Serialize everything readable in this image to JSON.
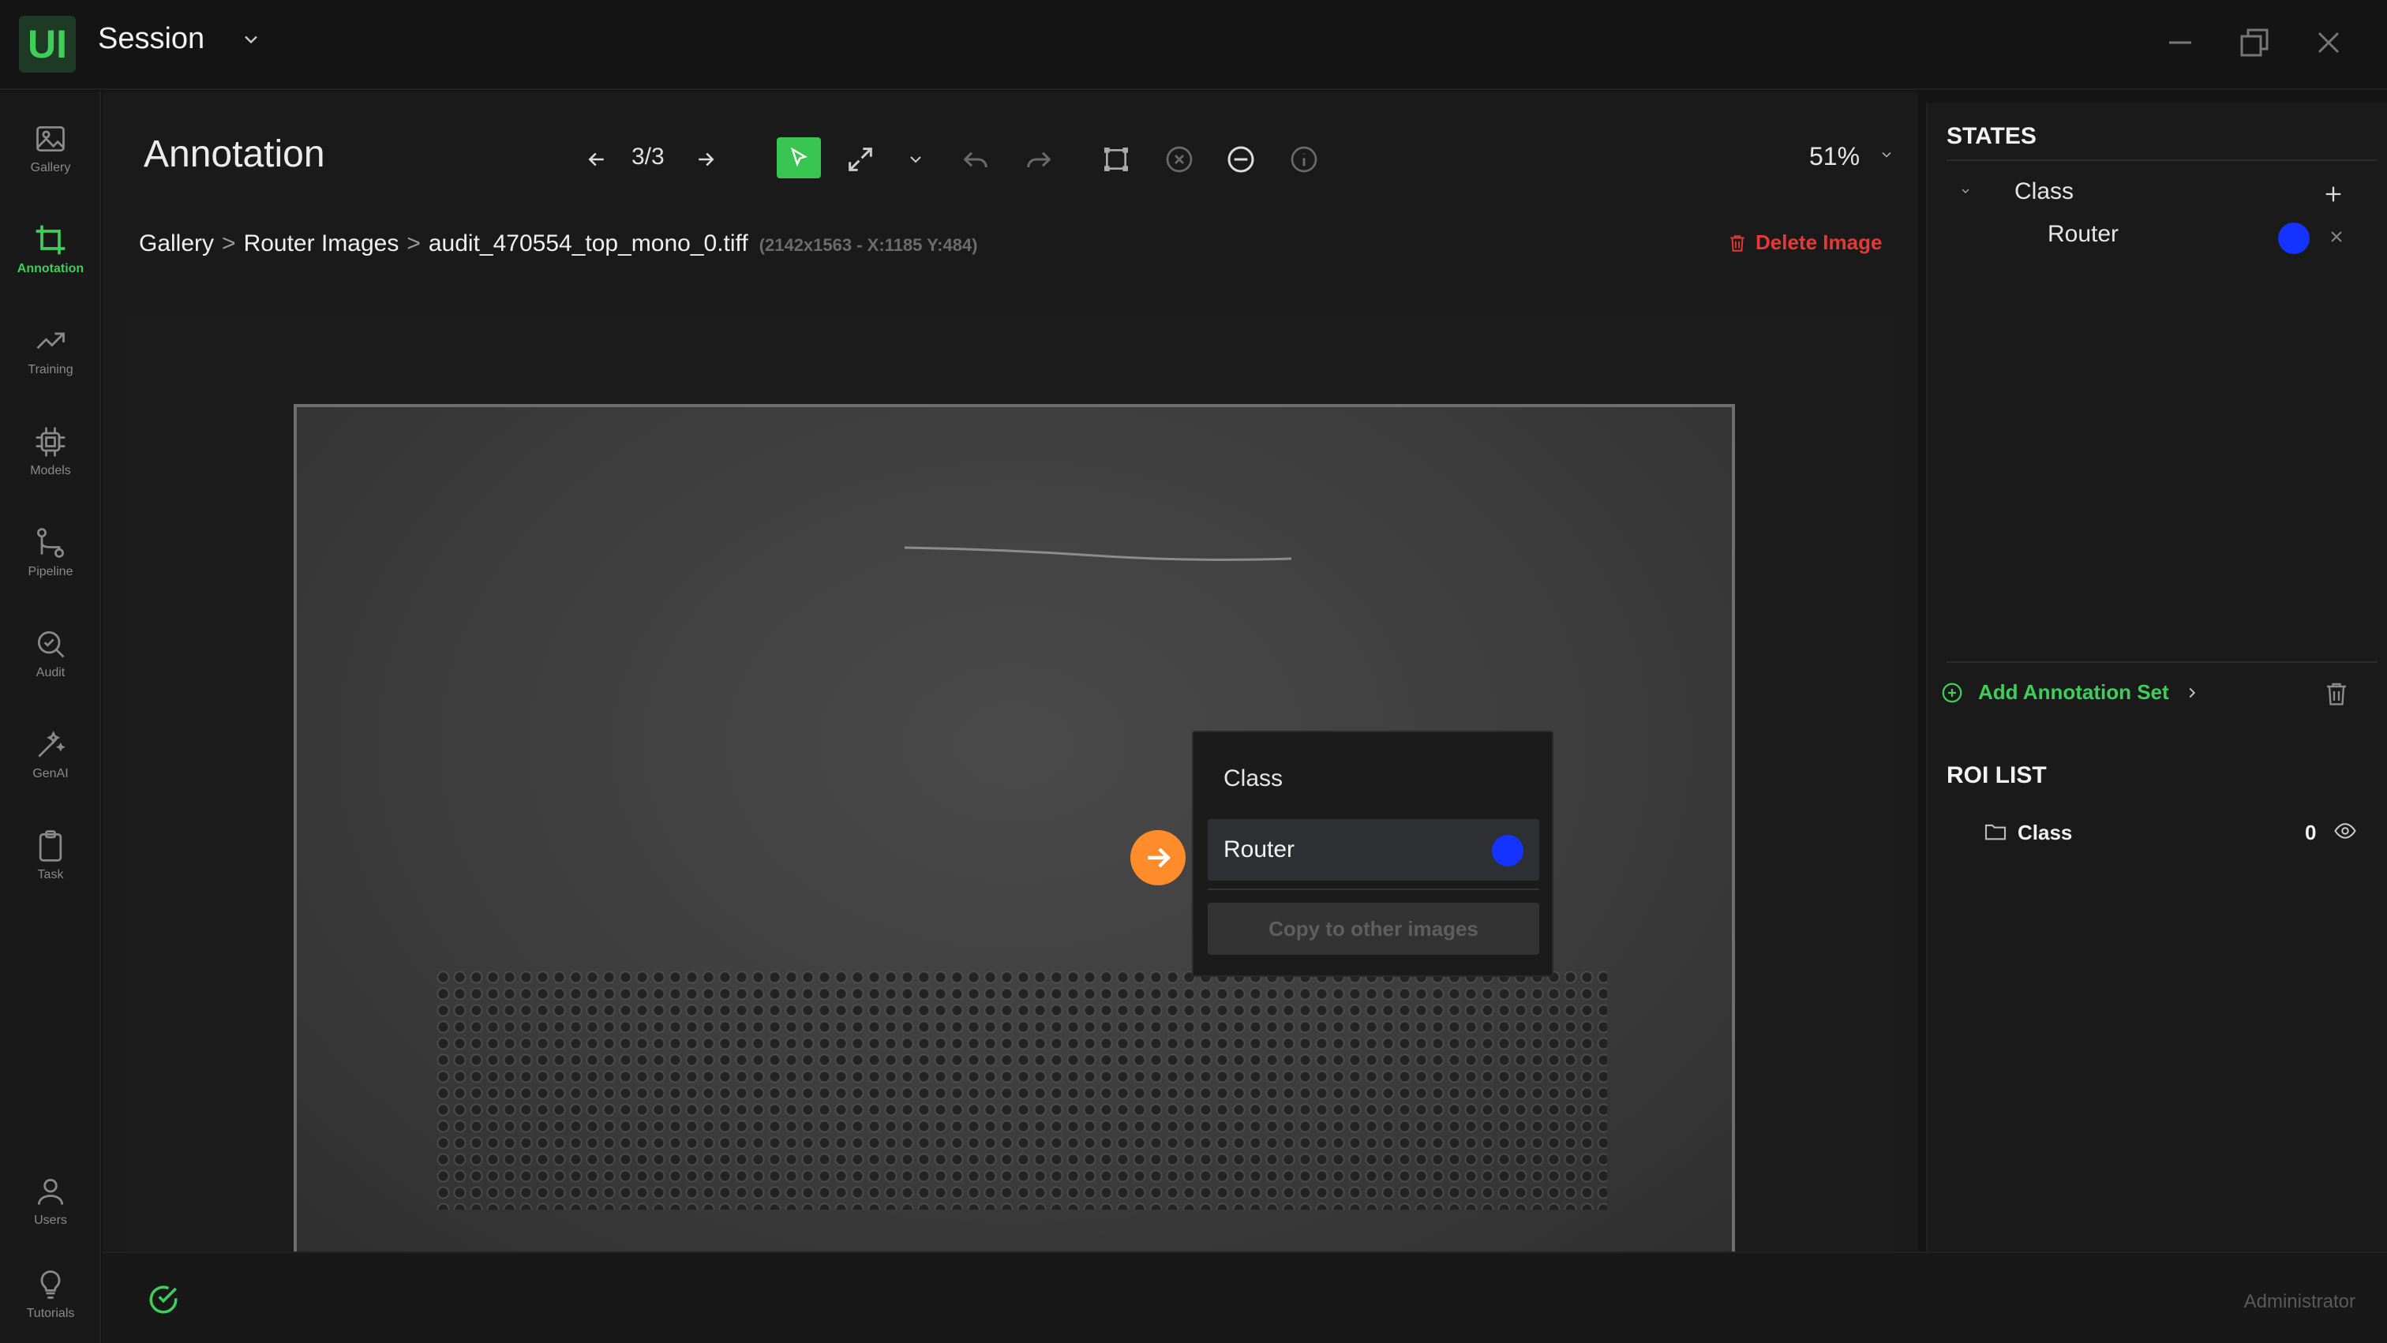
{
  "app": {
    "logo_text": "UI",
    "session_label": "Session"
  },
  "nav": [
    {
      "label": "Gallery",
      "icon": "image-icon"
    },
    {
      "label": "Annotation",
      "icon": "crop-icon",
      "active": true
    },
    {
      "label": "Training",
      "icon": "trend-icon"
    },
    {
      "label": "Models",
      "icon": "chip-icon"
    },
    {
      "label": "Pipeline",
      "icon": "pipeline-icon"
    },
    {
      "label": "Audit",
      "icon": "search-icon"
    },
    {
      "label": "GenAI",
      "icon": "wand-icon"
    },
    {
      "label": "Task",
      "icon": "clipboard-icon"
    },
    {
      "label": "Users",
      "icon": "user-icon"
    },
    {
      "label": "Tutorials",
      "icon": "bulb-icon"
    }
  ],
  "toolbar": {
    "title": "Annotation",
    "counter": "3/3",
    "zoom": "51%"
  },
  "breadcrumb": {
    "items": [
      "Gallery",
      "Router Images",
      "audit_470554_top_mono_0.tiff"
    ],
    "separator": ">",
    "dims": "(2142x1563 - X:1185 Y:484)"
  },
  "delete_label": "Delete Image",
  "popup": {
    "title": "Class",
    "item_label": "Router",
    "item_color": "#1433ff",
    "copy_label": "Copy to other images"
  },
  "states": {
    "title": "STATES",
    "group": "Class",
    "item": "Router",
    "item_color": "#1433ff"
  },
  "add_annotation_set": "Add Annotation Set",
  "roi": {
    "title": "ROI LIST",
    "label": "Class",
    "count": "0"
  },
  "footer": {
    "user": "Administrator"
  },
  "colors": {
    "accent_green": "#3ecf5a",
    "danger": "#e53935",
    "highlight_orange": "#ff8c2a"
  }
}
